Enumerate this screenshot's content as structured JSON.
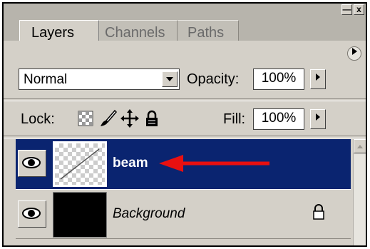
{
  "window": {
    "minimize_label": "—",
    "close_label": "x"
  },
  "tabs": [
    {
      "label": "Layers",
      "active": true
    },
    {
      "label": "Channels",
      "active": false
    },
    {
      "label": "Paths",
      "active": false
    }
  ],
  "panel_menu_icon": "triangle-right-icon",
  "blend_mode": {
    "value": "Normal",
    "icon": "chevron-down-icon"
  },
  "opacity": {
    "label": "Opacity:",
    "value": "100%"
  },
  "lock": {
    "label": "Lock:",
    "icons": [
      "lock-transparent-icon",
      "lock-brush-icon",
      "lock-move-icon",
      "lock-all-icon"
    ]
  },
  "fill": {
    "label": "Fill:",
    "value": "100%"
  },
  "layers": [
    {
      "name": "beam",
      "selected": true,
      "visible": true,
      "thumbnail": "transparent-with-line",
      "locked": false
    },
    {
      "name": "Background",
      "selected": false,
      "visible": true,
      "thumbnail": "black",
      "locked": true
    }
  ],
  "annotation": {
    "type": "red-arrow",
    "color": "#e81010",
    "points_to": "beam"
  },
  "colors": {
    "panel": "#d4d0c8",
    "selection": "#0a2470",
    "arrow": "#e81010"
  }
}
